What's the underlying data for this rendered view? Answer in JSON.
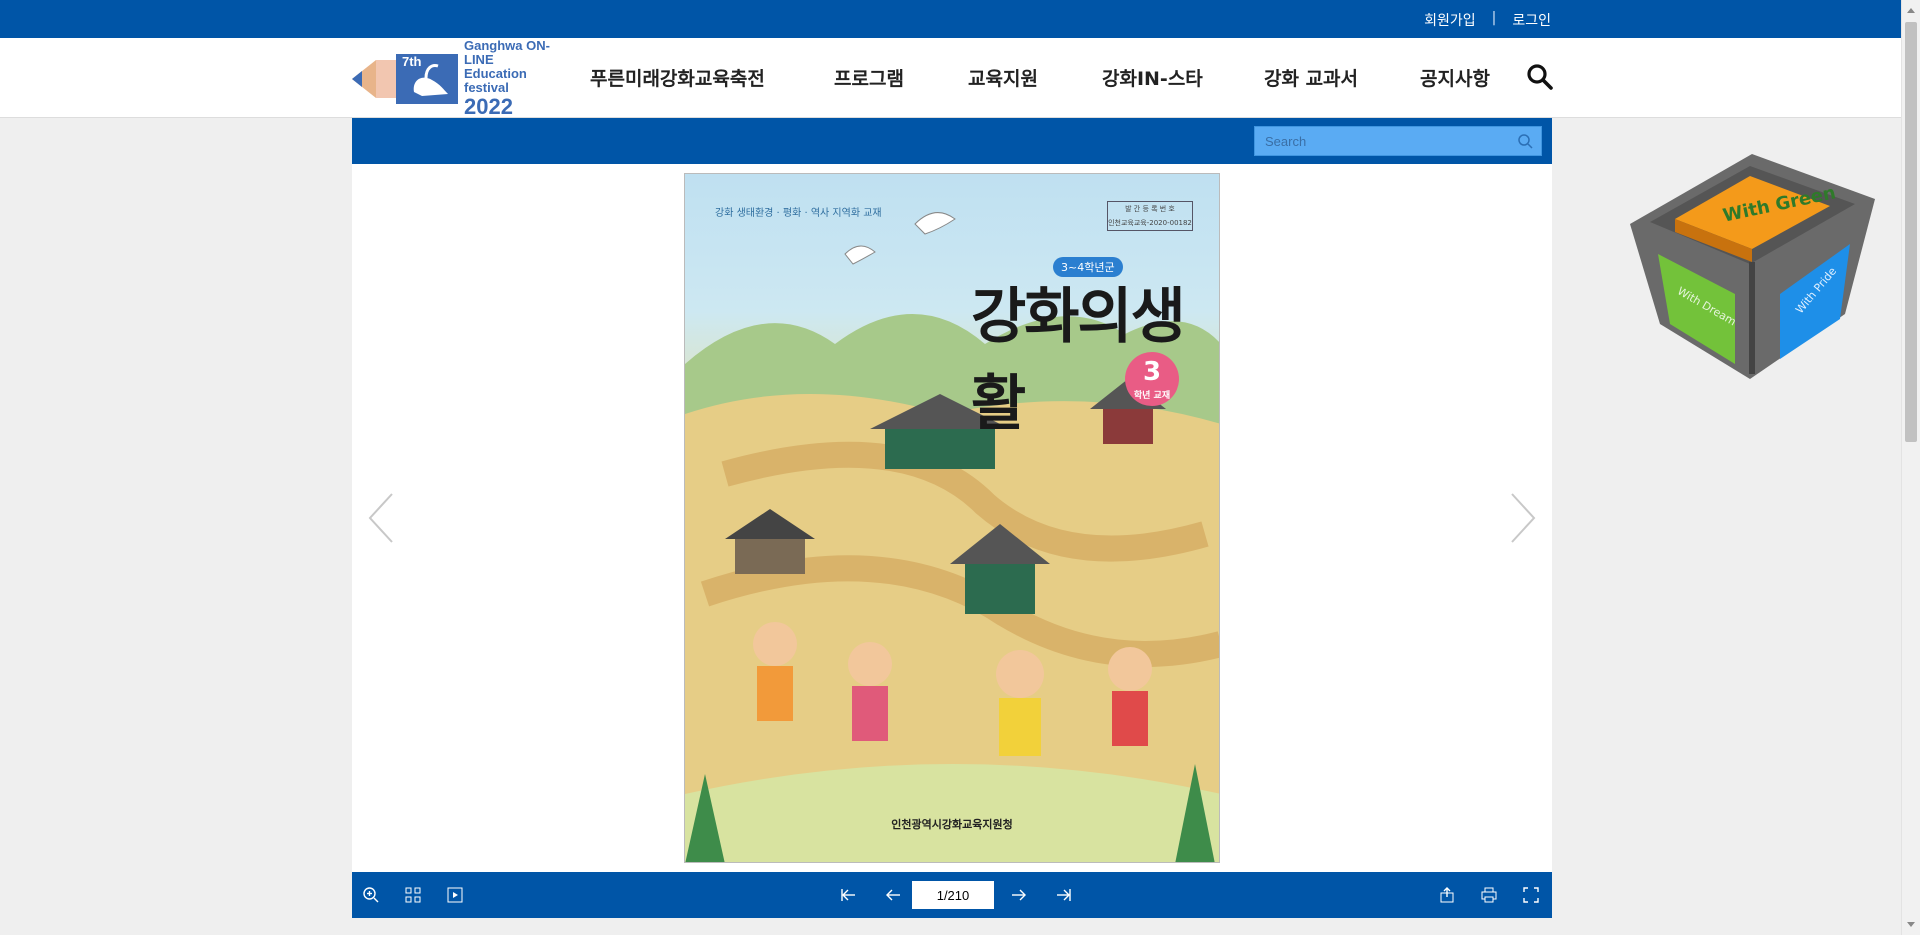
{
  "topbar": {
    "join": "회원가입",
    "separator": "|",
    "login": "로그인"
  },
  "logo": {
    "edition": "7th",
    "line1": "Ganghwa ON-LINE",
    "line2": "Education festival",
    "year": "2022"
  },
  "nav": [
    {
      "label": "푸른미래강화교육축전"
    },
    {
      "label": "프로그램"
    },
    {
      "label": "교육지원"
    },
    {
      "label": "강화IN-스타"
    },
    {
      "label": "강화 교과서"
    },
    {
      "label": "공지사항"
    }
  ],
  "viewer": {
    "search_placeholder": "Search",
    "page_current": "1/210",
    "page_left_marker": "",
    "page_right_marker": "",
    "book": {
      "subtitle": "강화 생태환경 · 평화 · 역사 지역화 교재",
      "registration_box_line1": "발 간 등 록 번 호",
      "registration_box_line2": "인천교육교육-2020-00182",
      "grade_tag": "3~4학년군",
      "title": "강화의생활",
      "badge_number": "3",
      "badge_text": "학년 교재",
      "publisher": "인천광역시강화교육지원청"
    }
  },
  "cube": {
    "top_text": "With Green",
    "left_text": "With Dream",
    "right_text": "With Pride"
  },
  "colors": {
    "brand": "#0055a7",
    "search_bg": "#5aabf3",
    "badge": "#e95c85"
  }
}
